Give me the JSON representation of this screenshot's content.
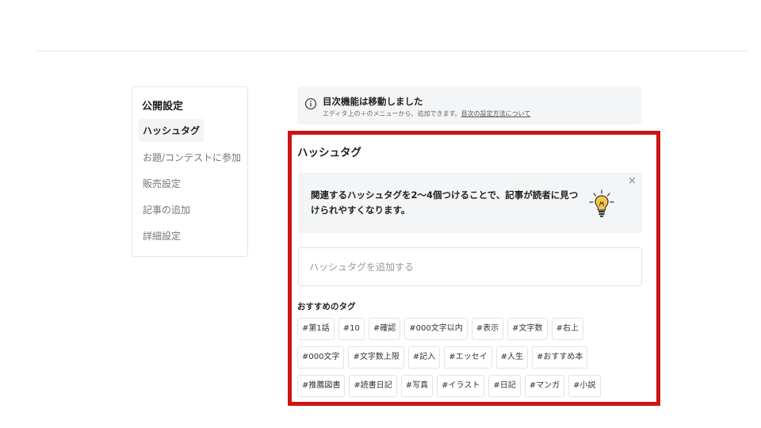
{
  "sidebar": {
    "title": "公開設定",
    "items": [
      {
        "label": "ハッシュタグ",
        "active": true
      },
      {
        "label": "お題/コンテストに参加",
        "active": false
      },
      {
        "label": "販売設定",
        "active": false
      },
      {
        "label": "記事の追加",
        "active": false
      },
      {
        "label": "詳細設定",
        "active": false
      }
    ]
  },
  "notice": {
    "icon": "info-icon",
    "title": "目次機能は移動しました",
    "description": "エディタ上の＋のメニューから、追加できます。",
    "link_text": "目次の設定方法について"
  },
  "hashtag": {
    "section_title": "ハッシュタグ",
    "tip_text": "関連するハッシュタグを2〜4個つけることで、記事が読者に見つけられやすくなります。",
    "tip_close": "×",
    "tip_icon": "lightbulb-icon",
    "input_placeholder": "ハッシュタグを追加する",
    "recommended_label": "おすすめのタグ",
    "tag_rows": [
      [
        "#第1話",
        "#10",
        "#確認",
        "#000文字以内",
        "#表示",
        "#文字数",
        "#右上"
      ],
      [
        "#000文字",
        "#文字数上限",
        "#記入",
        "#エッセイ",
        "#人生",
        "#おすすめ本"
      ],
      [
        "#推薦図書",
        "#読書日記",
        "#写真",
        "#イラスト",
        "#日記",
        "#マンガ",
        "#小説"
      ]
    ]
  },
  "colors": {
    "highlight": "#cc1414",
    "panel_background": "#f4f5f6",
    "border": "#e3e3e3"
  }
}
